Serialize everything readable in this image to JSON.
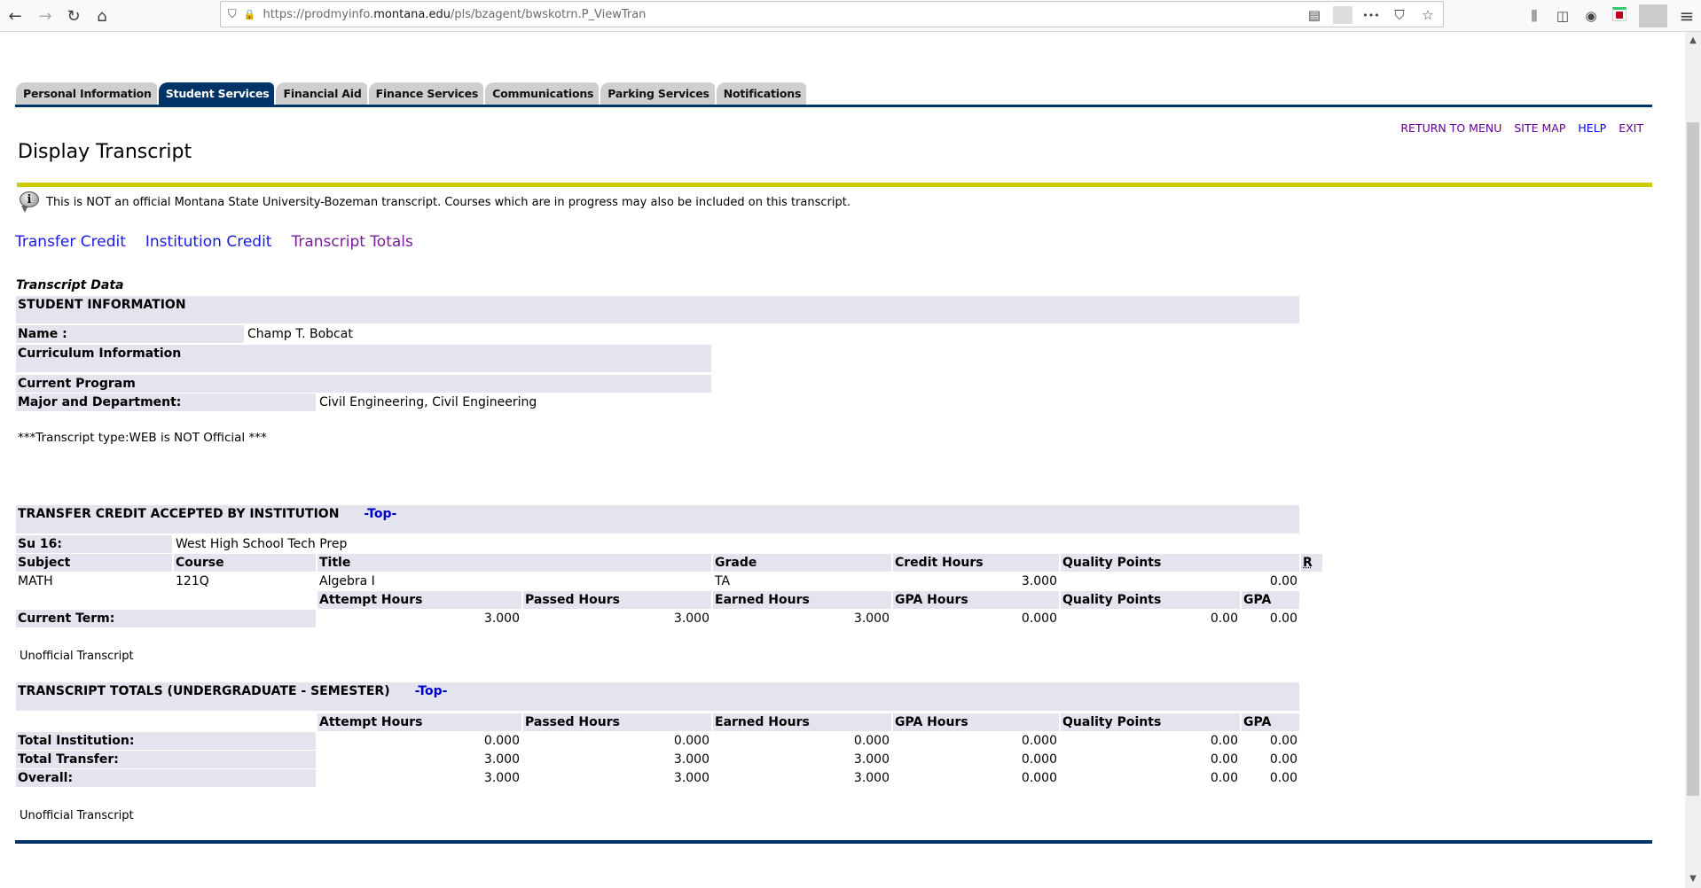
{
  "browser": {
    "url_prefix": "https://prodmyinfo.",
    "url_domain": "montana.edu",
    "url_path": "/pls/bzagent/bwskotrn.P_ViewTran",
    "icons": {
      "back": "←",
      "forward": "→",
      "reload": "↻",
      "home": "⌂",
      "shield": "⛉",
      "lock": "🔒",
      "reader": "▤",
      "more": "•••",
      "pocket": "⛉",
      "star": "☆",
      "library": "⫼",
      "sidebar": "◫",
      "account": "◉",
      "menu": "≡"
    }
  },
  "tabs": [
    {
      "label": "Personal Information",
      "active": false
    },
    {
      "label": "Student Services",
      "active": true
    },
    {
      "label": "Financial Aid",
      "active": false
    },
    {
      "label": "Finance Services",
      "active": false
    },
    {
      "label": "Communications",
      "active": false
    },
    {
      "label": "Parking Services",
      "active": false
    },
    {
      "label": "Notifications",
      "active": false
    }
  ],
  "top_links": {
    "return_to_menu": "RETURN TO MENU",
    "site_map": "SITE MAP",
    "help": "HELP",
    "exit": "EXIT"
  },
  "page_title": "Display Transcript",
  "info_message": "This is NOT an official Montana State University-Bozeman transcript. Courses which are in progress may also be included on this transcript.",
  "anchor_links": {
    "transfer_credit": "Transfer Credit",
    "institution_credit": "Institution Credit",
    "transcript_totals": "Transcript Totals"
  },
  "transcript": {
    "caption": "Transcript Data",
    "student_info": {
      "header": "STUDENT INFORMATION",
      "name_label": "Name :",
      "name_value": "Champ T. Bobcat",
      "curriculum_label": "Curriculum Information",
      "program_label": "Current Program",
      "major_label": "Major and Department:",
      "major_value": "Civil Engineering, Civil Engineering"
    },
    "transcript_type": "***Transcript type:WEB is NOT Official ***",
    "transfer": {
      "header": "TRANSFER CREDIT ACCEPTED BY INSTITUTION",
      "top_link": "-Top-",
      "term_label": "Su 16:",
      "term_value": "West High School Tech Prep",
      "course_headers": {
        "subject": "Subject",
        "course": "Course",
        "title": "Title",
        "grade": "Grade",
        "credit_hours": "Credit Hours",
        "quality_points": "Quality Points",
        "r": "R"
      },
      "courses": [
        {
          "subject": "MATH",
          "course": "121Q",
          "title": "Algebra I",
          "grade": "TA",
          "credit_hours": "3.000",
          "quality_points": "0.00",
          "r": ""
        }
      ],
      "term_headers": {
        "attempt": "Attempt Hours",
        "passed": "Passed Hours",
        "earned": "Earned Hours",
        "gpa_hours": "GPA Hours",
        "quality_points": "Quality Points",
        "gpa": "GPA"
      },
      "current_term": {
        "label": "Current Term:",
        "attempt": "3.000",
        "passed": "3.000",
        "earned": "3.000",
        "gpa_hours": "0.000",
        "quality_points": "0.00",
        "gpa": "0.00"
      }
    },
    "unofficial_1": "Unofficial Transcript",
    "totals": {
      "header": "TRANSCRIPT TOTALS (UNDERGRADUATE - SEMESTER)",
      "top_link": "-Top-",
      "headers": {
        "attempt": "Attempt Hours",
        "passed": "Passed Hours",
        "earned": "Earned Hours",
        "gpa_hours": "GPA Hours",
        "quality_points": "Quality Points",
        "gpa": "GPA"
      },
      "rows": [
        {
          "label": "Total Institution:",
          "attempt": "0.000",
          "passed": "0.000",
          "earned": "0.000",
          "gpa_hours": "0.000",
          "quality_points": "0.00",
          "gpa": "0.00"
        },
        {
          "label": "Total Transfer:",
          "attempt": "3.000",
          "passed": "3.000",
          "earned": "3.000",
          "gpa_hours": "0.000",
          "quality_points": "0.00",
          "gpa": "0.00"
        },
        {
          "label": "Overall:",
          "attempt": "3.000",
          "passed": "3.000",
          "earned": "3.000",
          "gpa_hours": "0.000",
          "quality_points": "0.00",
          "gpa": "0.00"
        }
      ]
    },
    "unofficial_2": "Unofficial Transcript"
  }
}
